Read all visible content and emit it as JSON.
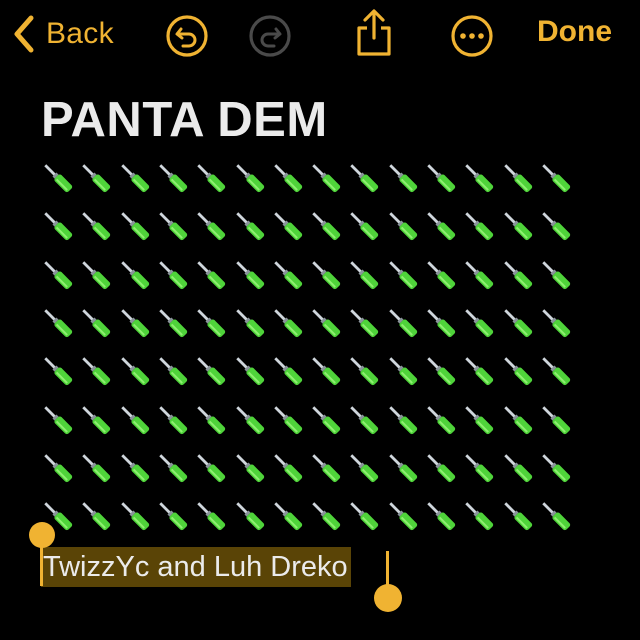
{
  "toolbar": {
    "back_label": "Back",
    "done_label": "Done",
    "accent_color": "#f0b332"
  },
  "note": {
    "title": "PANTA DEM",
    "body_emoji": {
      "icon": "screwdriver-emoji",
      "rows": 8,
      "columns": 14,
      "color": "#4fd33a"
    },
    "selected_text": "TwizzYc and Luh Dreko"
  }
}
